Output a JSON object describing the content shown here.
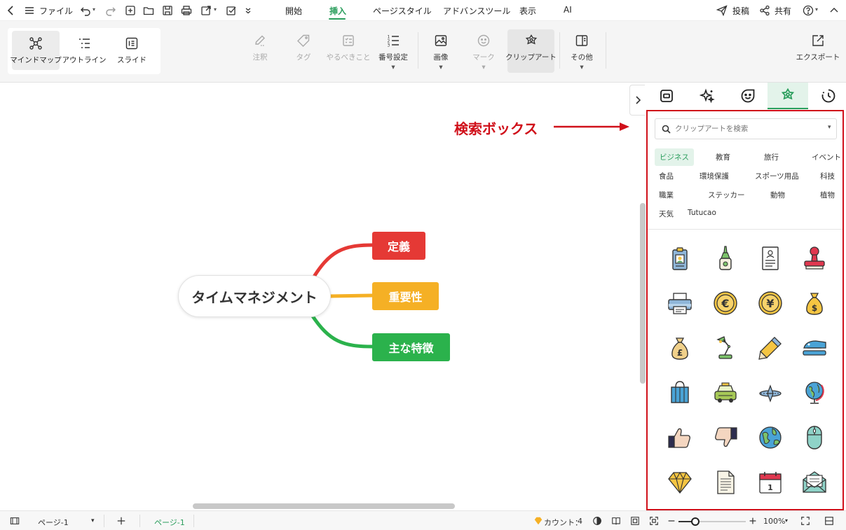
{
  "titlebar": {
    "file_label": "ファイル",
    "tabs": [
      "開始",
      "挿入",
      "ページスタイル",
      "アドバンスツール",
      "表示",
      "AI"
    ],
    "active_tab": "挿入",
    "post_label": "投稿",
    "share_label": "共有"
  },
  "ribbon": {
    "views": [
      "マインドマップ",
      "アウトライン",
      "スライド"
    ],
    "tools": [
      "注釈",
      "タグ",
      "やるべきこと",
      "番号設定",
      "画像",
      "マーク",
      "クリップアート",
      "その他"
    ],
    "export_label": "エクスポート"
  },
  "mindmap": {
    "central": "タイムマネジメント",
    "branches": [
      {
        "label": "定義",
        "color": "#e53935"
      },
      {
        "label": "重要性",
        "color": "#f5b025"
      },
      {
        "label": "主な特徴",
        "color": "#2bb24c"
      }
    ]
  },
  "annotation": {
    "label": "検索ボックス",
    "color": "#d0101a"
  },
  "panel": {
    "search_placeholder": "クリップアートを検索",
    "categories": [
      "ビジネス",
      "教育",
      "旅行",
      "イベント",
      "食品",
      "環境保護",
      "スポーツ用品",
      "科技",
      "職業",
      "ステッカー",
      "動物",
      "植物",
      "天気",
      "Tutucao"
    ],
    "active_category": "ビジネス",
    "clipart_icons": [
      "id-badge-icon",
      "glue-bottle-icon",
      "resume-document-icon",
      "rubber-stamp-icon",
      "printer-icon",
      "euro-coin-icon",
      "yen-coin-icon",
      "dollar-bag-icon",
      "pound-bag-icon",
      "desk-lamp-icon",
      "pencil-icon",
      "stapler-icon",
      "binder-clip-icon",
      "taxi-icon",
      "airplane-icon",
      "desk-globe-icon",
      "thumbs-up-icon",
      "thumbs-down-icon",
      "earth-icon",
      "mouse-icon",
      "diamond-icon",
      "text-document-icon",
      "calendar-icon",
      "envelope-icon"
    ],
    "calendar_day": "1"
  },
  "statusbar": {
    "page_select": "ページ-1",
    "page_tab": "ページ-1",
    "count_label": "カウント：",
    "count_value": "4",
    "zoom": "100%"
  },
  "colors": {
    "accent": "#2a9d5c",
    "highlight_border": "#d0101a"
  }
}
